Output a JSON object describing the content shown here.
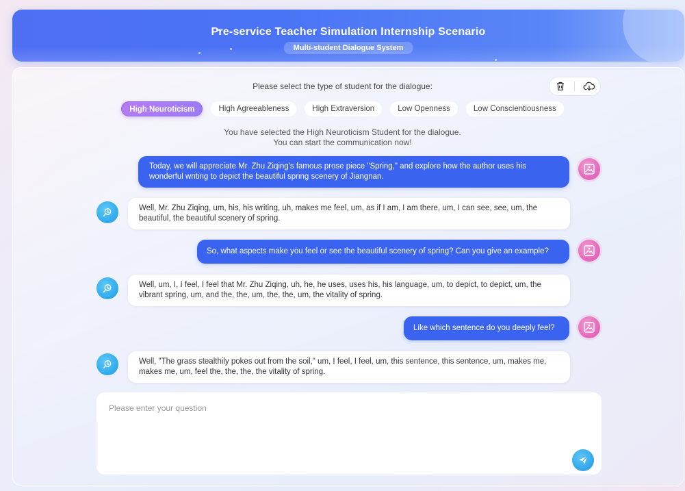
{
  "header": {
    "title": "Pre-service Teacher Simulation Internship Scenario",
    "subtitle": "Multi-student Dialogue System"
  },
  "selector": {
    "prompt": "Please select the type of student for the dialogue:",
    "types": [
      {
        "label": "High Neuroticism",
        "active": true
      },
      {
        "label": "High Agreeableness",
        "active": false
      },
      {
        "label": "High Extraversion",
        "active": false
      },
      {
        "label": "Low Openness",
        "active": false
      },
      {
        "label": "Low Conscientiousness",
        "active": false
      }
    ],
    "selected_line1": "You have selected the High Neuroticism Student for the dialogue.",
    "selected_line2": "You can start the communication now!"
  },
  "toolbar": {
    "delete_icon": "trash-icon",
    "download_icon": "cloud-download-icon"
  },
  "messages": [
    {
      "role": "teacher",
      "text": "Today, we will appreciate Mr. Zhu Ziqing's famous prose piece \"Spring,\" and explore how the author uses his wonderful writing to depict the beautiful spring scenery of Jiangnan."
    },
    {
      "role": "student",
      "text": "Well, Mr. Zhu Ziqing, um, his, his writing, uh, makes me feel, um, as if I am, I am there, um, I can see, see, um, the beautiful, the beautiful scenery of spring."
    },
    {
      "role": "teacher",
      "text": "So, what aspects make you feel or see the beautiful scenery of spring? Can you give an example?"
    },
    {
      "role": "student",
      "text": "Well, um, I, I feel, I feel that Mr. Zhu Ziqing, uh, he, he uses, uses his, his language, um, to depict, to depict, um, the vibrant spring, um, and the, the, um, the, the, um, the vitality of spring."
    },
    {
      "role": "teacher",
      "text": "Like which sentence do you deeply feel?"
    },
    {
      "role": "student",
      "text": "Well, \"The grass stealthily pokes out from the soil,\" um, I feel, I feel, um, this sentence, this sentence, um, makes me, makes me, um, feel the, the, the, the vitality of spring."
    }
  ],
  "input": {
    "placeholder": "Please enter your question",
    "value": ""
  },
  "colors": {
    "accent": "#3a63f0",
    "active_chip": "#a97bf3",
    "teacher_avatar": "#e46bbb",
    "student_avatar": "#2fa8ec"
  }
}
